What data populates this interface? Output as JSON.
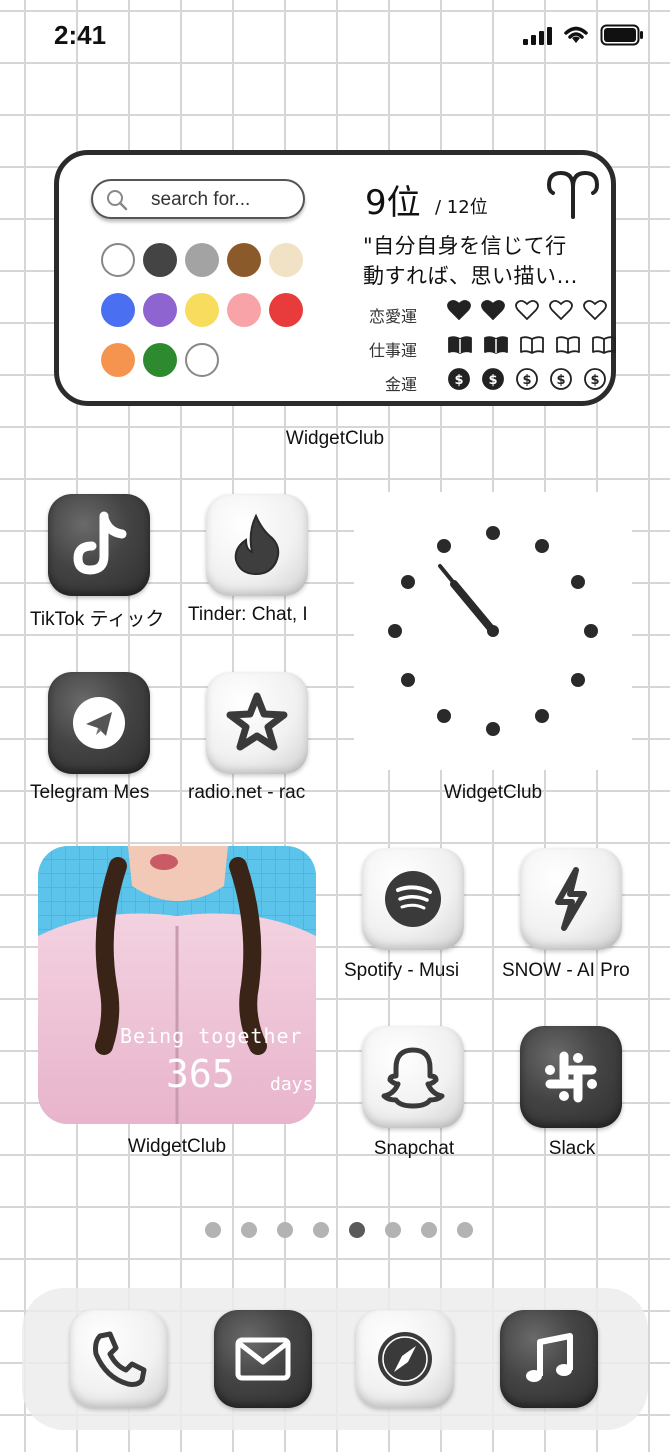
{
  "status_bar": {
    "time": "2:41"
  },
  "horoscope_widget": {
    "search_placeholder": "search for...",
    "rank": "9位",
    "rank_total": "/ 12位",
    "quote_line1": "\"自分自身を信じて行",
    "quote_line2": "動すれば、思い描い…",
    "love_label": "恋愛運",
    "work_label": "仕事運",
    "money_label": "金運",
    "love_rating": 2,
    "work_rating": 2,
    "money_rating": 2,
    "max_rating": 5,
    "colors": [
      "#ffffff",
      "#444444",
      "#a3a3a3",
      "#8a5a2b",
      "#f1e1c5",
      "#4a6ff0",
      "#8d64d0",
      "#f8dc5e",
      "#f7a3a8",
      "#e83b3b",
      "#f5944f",
      "#2e8a2e",
      "#ffffff"
    ],
    "caption": "WidgetClub"
  },
  "apps": {
    "tiktok": "TikTok ティック",
    "tinder": "Tinder: Chat, I",
    "telegram": "Telegram Mes",
    "radio": "radio.net - rac",
    "spotify": "Spotify - Musi",
    "snow": "SNOW - AI Pro",
    "snapchat": "Snapchat",
    "slack": "Slack"
  },
  "clock_widget": {
    "caption": "WidgetClub"
  },
  "photo_widget": {
    "text": "Being together",
    "number": "365",
    "unit": "days",
    "caption": "WidgetClub"
  },
  "page_indicator": {
    "count": 8,
    "active": 5
  },
  "dock": {
    "phone": "phone-icon",
    "mail": "mail-icon",
    "safari": "compass-icon",
    "music": "music-icon"
  }
}
